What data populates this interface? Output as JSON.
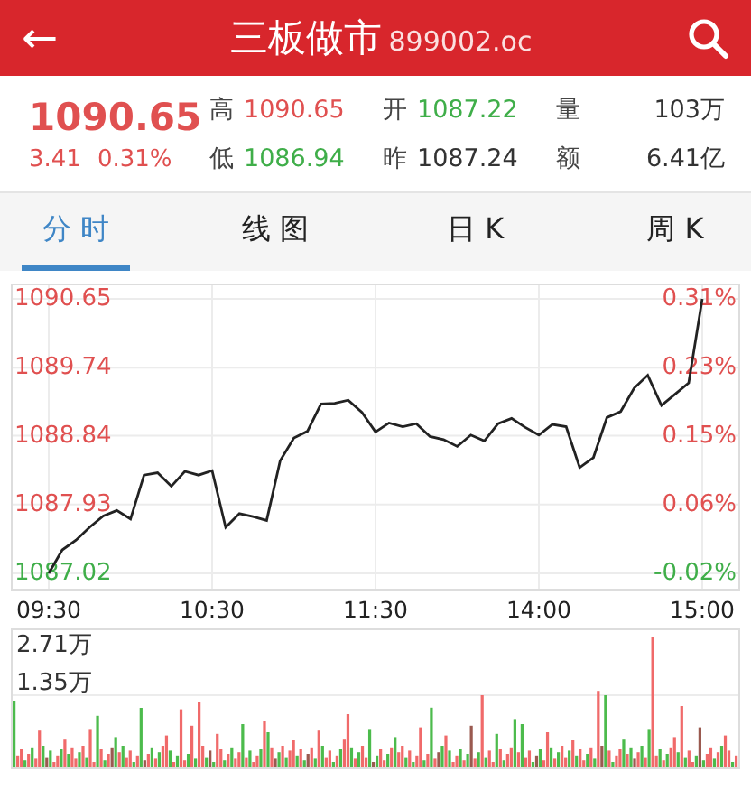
{
  "header": {
    "back": "←",
    "title": "三板做市",
    "code": "899002.oc"
  },
  "quote": {
    "price": "1090.65",
    "change": "3.41",
    "percent": "0.31%",
    "color": "#e05050",
    "stats": [
      {
        "label": "高",
        "value": "1090.65",
        "color": "#e05050"
      },
      {
        "label": "开",
        "value": "1087.22",
        "color": "#3fae49"
      },
      {
        "label": "量",
        "value": "103万",
        "color": "#333333"
      },
      {
        "label": "低",
        "value": "1086.94",
        "color": "#3fae49"
      },
      {
        "label": "昨",
        "value": "1087.24",
        "color": "#333333"
      },
      {
        "label": "额",
        "value": "6.41亿",
        "color": "#333333"
      }
    ]
  },
  "tabs": [
    {
      "label": "分 时",
      "selected": true
    },
    {
      "label": "线 图",
      "selected": false
    },
    {
      "label": "日 K",
      "selected": false
    },
    {
      "label": "周 K",
      "selected": false
    }
  ],
  "price_chart": {
    "left_labels": [
      {
        "text": "1090.65",
        "color": "#e05050"
      },
      {
        "text": "1089.74",
        "color": "#e05050"
      },
      {
        "text": "1088.84",
        "color": "#e05050"
      },
      {
        "text": "1087.93",
        "color": "#e05050"
      },
      {
        "text": "1087.02",
        "color": "#3fae49"
      }
    ],
    "right_labels": [
      {
        "text": "0.31%",
        "color": "#e05050"
      },
      {
        "text": "0.23%",
        "color": "#e05050"
      },
      {
        "text": "0.15%",
        "color": "#e05050"
      },
      {
        "text": "0.06%",
        "color": "#e05050"
      },
      {
        "text": "-0.02%",
        "color": "#3fae49"
      }
    ],
    "chart_data": {
      "type": "line",
      "grid": true,
      "ylim": [
        1087.02,
        1090.65
      ],
      "yticks": [
        1087.02,
        1087.93,
        1088.84,
        1089.74,
        1090.65
      ],
      "categories": [
        "09:30",
        null,
        null,
        null,
        null,
        null,
        null,
        null,
        null,
        null,
        null,
        null,
        "10:30",
        null,
        null,
        null,
        null,
        null,
        null,
        null,
        null,
        null,
        null,
        null,
        "11:30",
        null,
        null,
        null,
        null,
        null,
        null,
        null,
        null,
        null,
        null,
        null,
        "14:00",
        null,
        null,
        null,
        null,
        null,
        null,
        null,
        null,
        null,
        null,
        null,
        "15:00"
      ],
      "series": [
        {
          "color": "#222222",
          "values": [
            1087.02,
            1087.33,
            1087.46,
            1087.63,
            1087.78,
            1087.85,
            1087.74,
            1088.32,
            1088.35,
            1088.17,
            1088.37,
            1088.32,
            1088.38,
            1087.63,
            1087.81,
            1087.77,
            1087.72,
            1088.51,
            1088.81,
            1088.9,
            1089.26,
            1089.27,
            1089.31,
            1089.15,
            1088.89,
            1089.01,
            1088.96,
            1089.0,
            1088.83,
            1088.79,
            1088.7,
            1088.85,
            1088.77,
            1089.0,
            1089.07,
            1088.95,
            1088.85,
            1088.99,
            1088.96,
            1088.42,
            1088.55,
            1089.08,
            1089.16,
            1089.47,
            1089.64,
            1089.24,
            1089.39,
            1089.54,
            1090.65
          ]
        }
      ]
    }
  },
  "volume_chart": {
    "labels": [
      "2.71万",
      "1.35万"
    ]
  }
}
